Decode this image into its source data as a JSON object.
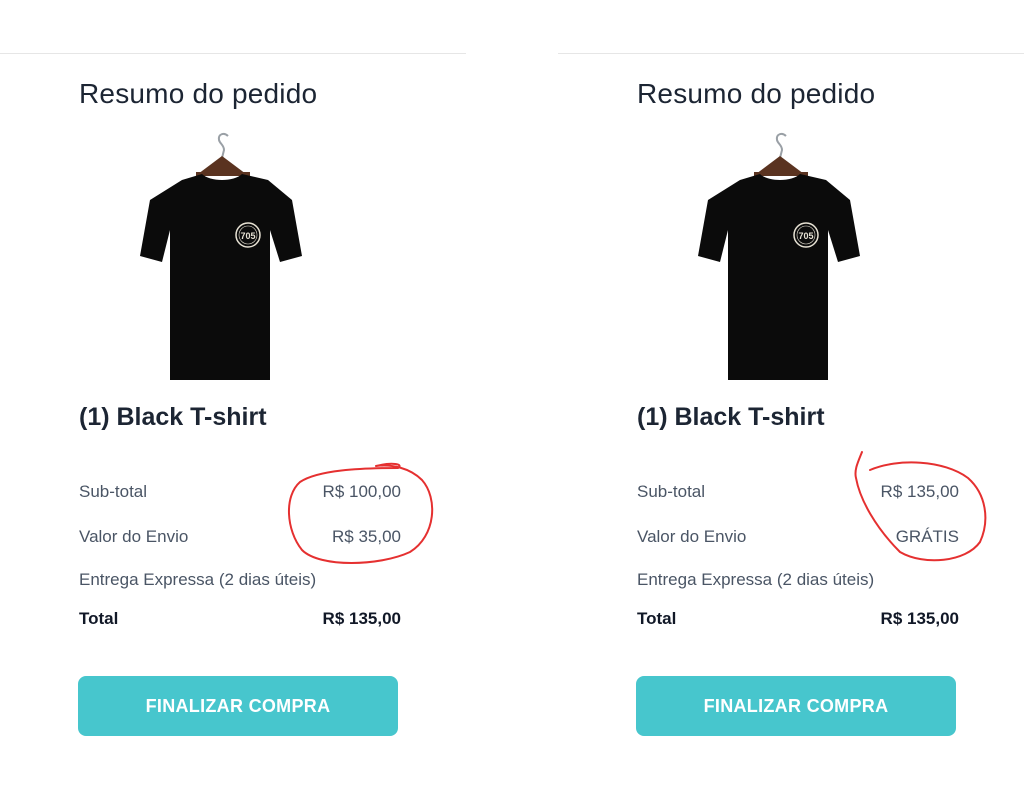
{
  "colors": {
    "accent": "#47c6cd",
    "annotation": "#e53030",
    "text_dark": "#1c2533",
    "text_muted": "#4a5565"
  },
  "panels": [
    {
      "title": "Resumo do pedido",
      "product_icon": "black-tshirt-on-hanger",
      "badge_text": "705",
      "product_name": "(1) Black T-shirt",
      "subtotal_label": "Sub-total",
      "subtotal_value": "R$ 100,00",
      "shipping_label": "Valor do Envio",
      "shipping_value": "R$ 35,00",
      "delivery_label": "Entrega Expressa (2 dias úteis)",
      "total_label": "Total",
      "total_value": "R$ 135,00",
      "button_label": "FINALIZAR COMPRA"
    },
    {
      "title": "Resumo do pedido",
      "product_icon": "black-tshirt-on-hanger",
      "badge_text": "705",
      "product_name": "(1) Black T-shirt",
      "subtotal_label": "Sub-total",
      "subtotal_value": "R$ 135,00",
      "shipping_label": "Valor do Envio",
      "shipping_value": "GRÁTIS",
      "delivery_label": "Entrega Expressa (2 dias úteis)",
      "total_label": "Total",
      "total_value": "R$ 135,00",
      "button_label": "FINALIZAR COMPRA"
    }
  ]
}
